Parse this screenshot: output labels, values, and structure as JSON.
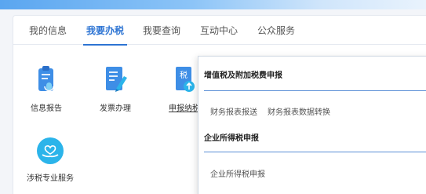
{
  "tabs": [
    {
      "label": "我的信息"
    },
    {
      "label": "我要办税"
    },
    {
      "label": "我要查询"
    },
    {
      "label": "互动中心"
    },
    {
      "label": "公众服务"
    }
  ],
  "active_tab": "我要办税",
  "services": [
    {
      "label": "信息报告",
      "icon": "clipboard-mic-icon"
    },
    {
      "label": "发票办理",
      "icon": "invoice-pen-icon"
    },
    {
      "label": "申报纳税",
      "icon": "tax-upload-icon"
    },
    {
      "label": "涉税专业服务",
      "icon": "heart-hand-icon"
    }
  ],
  "popup": {
    "sections": [
      {
        "title": "增值税及附加税费申报",
        "links": [
          "财务报表报送",
          "财务报表数据转换"
        ]
      },
      {
        "title": "企业所得税申报",
        "links": [
          "企业所得税申报"
        ]
      }
    ]
  },
  "colors": {
    "accent": "#2d74d3",
    "icon_blue": "#3e8ee6",
    "icon_cyan": "#2bb4ea"
  }
}
